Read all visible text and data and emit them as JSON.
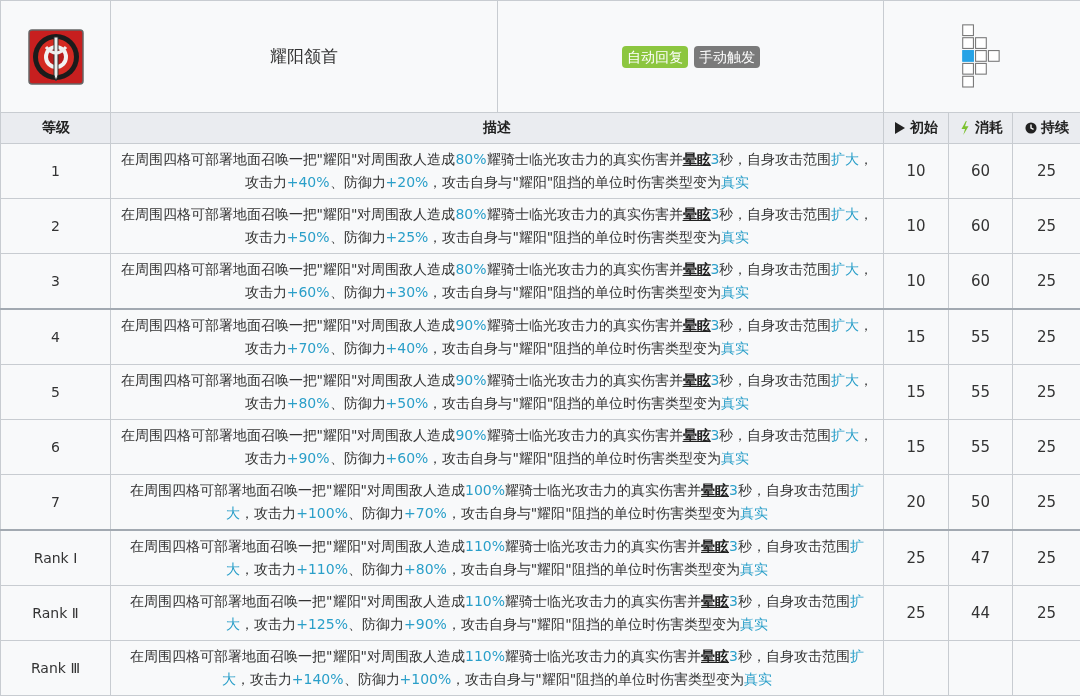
{
  "skill": {
    "name": "耀阳颔首",
    "tags": [
      {
        "label": "自动回复",
        "color": "#8cc63f"
      },
      {
        "label": "手动触发",
        "color": "#7a7a7a"
      }
    ]
  },
  "columns": [
    {
      "label": "等级",
      "kind": "level"
    },
    {
      "label": "描述",
      "kind": "description"
    },
    {
      "label": "初始",
      "kind": "initial"
    },
    {
      "label": "消耗",
      "kind": "cost"
    },
    {
      "label": "持续",
      "kind": "duration"
    }
  ],
  "rows": [
    {
      "level": "1",
      "description": [
        {
          "kind": "text",
          "text": "在周围四格可部署地面召唤一把\"耀阳\"对周围敌人造成"
        },
        {
          "kind": "value",
          "text": "80%"
        },
        {
          "kind": "text",
          "text": "耀骑士临光攻击力的真实伤害并"
        },
        {
          "kind": "term",
          "text": "晕眩"
        },
        {
          "kind": "value",
          "text": "3"
        },
        {
          "kind": "text",
          "text": "秒，自身攻击范围"
        },
        {
          "kind": "keyword",
          "text": "扩大"
        },
        {
          "kind": "text",
          "text": "，攻击力"
        },
        {
          "kind": "value",
          "text": "+40%"
        },
        {
          "kind": "text",
          "text": "、防御力"
        },
        {
          "kind": "value",
          "text": "+20%"
        },
        {
          "kind": "text",
          "text": "，攻击自身与\"耀阳\"阻挡的单位时伤害类型变为"
        },
        {
          "kind": "keyword",
          "text": "真实"
        }
      ],
      "initial": "10",
      "cost": "60",
      "duration": "25"
    },
    {
      "level": "2",
      "description": [
        {
          "kind": "text",
          "text": "在周围四格可部署地面召唤一把\"耀阳\"对周围敌人造成"
        },
        {
          "kind": "value",
          "text": "80%"
        },
        {
          "kind": "text",
          "text": "耀骑士临光攻击力的真实伤害并"
        },
        {
          "kind": "term",
          "text": "晕眩"
        },
        {
          "kind": "value",
          "text": "3"
        },
        {
          "kind": "text",
          "text": "秒，自身攻击范围"
        },
        {
          "kind": "keyword",
          "text": "扩大"
        },
        {
          "kind": "text",
          "text": "，攻击力"
        },
        {
          "kind": "value",
          "text": "+50%"
        },
        {
          "kind": "text",
          "text": "、防御力"
        },
        {
          "kind": "value",
          "text": "+25%"
        },
        {
          "kind": "text",
          "text": "，攻击自身与\"耀阳\"阻挡的单位时伤害类型变为"
        },
        {
          "kind": "keyword",
          "text": "真实"
        }
      ],
      "initial": "10",
      "cost": "60",
      "duration": "25"
    },
    {
      "level": "3",
      "description": [
        {
          "kind": "text",
          "text": "在周围四格可部署地面召唤一把\"耀阳\"对周围敌人造成"
        },
        {
          "kind": "value",
          "text": "80%"
        },
        {
          "kind": "text",
          "text": "耀骑士临光攻击力的真实伤害并"
        },
        {
          "kind": "term",
          "text": "晕眩"
        },
        {
          "kind": "value",
          "text": "3"
        },
        {
          "kind": "text",
          "text": "秒，自身攻击范围"
        },
        {
          "kind": "keyword",
          "text": "扩大"
        },
        {
          "kind": "text",
          "text": "，攻击力"
        },
        {
          "kind": "value",
          "text": "+60%"
        },
        {
          "kind": "text",
          "text": "、防御力"
        },
        {
          "kind": "value",
          "text": "+30%"
        },
        {
          "kind": "text",
          "text": "，攻击自身与\"耀阳\"阻挡的单位时伤害类型变为"
        },
        {
          "kind": "keyword",
          "text": "真实"
        }
      ],
      "initial": "10",
      "cost": "60",
      "duration": "25"
    },
    {
      "level": "4",
      "description": [
        {
          "kind": "text",
          "text": "在周围四格可部署地面召唤一把\"耀阳\"对周围敌人造成"
        },
        {
          "kind": "value",
          "text": "90%"
        },
        {
          "kind": "text",
          "text": "耀骑士临光攻击力的真实伤害并"
        },
        {
          "kind": "term",
          "text": "晕眩"
        },
        {
          "kind": "value",
          "text": "3"
        },
        {
          "kind": "text",
          "text": "秒，自身攻击范围"
        },
        {
          "kind": "keyword",
          "text": "扩大"
        },
        {
          "kind": "text",
          "text": "，攻击力"
        },
        {
          "kind": "value",
          "text": "+70%"
        },
        {
          "kind": "text",
          "text": "、防御力"
        },
        {
          "kind": "value",
          "text": "+40%"
        },
        {
          "kind": "text",
          "text": "，攻击自身与\"耀阳\"阻挡的单位时伤害类型变为"
        },
        {
          "kind": "keyword",
          "text": "真实"
        }
      ],
      "initial": "15",
      "cost": "55",
      "duration": "25"
    },
    {
      "level": "5",
      "description": [
        {
          "kind": "text",
          "text": "在周围四格可部署地面召唤一把\"耀阳\"对周围敌人造成"
        },
        {
          "kind": "value",
          "text": "90%"
        },
        {
          "kind": "text",
          "text": "耀骑士临光攻击力的真实伤害并"
        },
        {
          "kind": "term",
          "text": "晕眩"
        },
        {
          "kind": "value",
          "text": "3"
        },
        {
          "kind": "text",
          "text": "秒，自身攻击范围"
        },
        {
          "kind": "keyword",
          "text": "扩大"
        },
        {
          "kind": "text",
          "text": "，攻击力"
        },
        {
          "kind": "value",
          "text": "+80%"
        },
        {
          "kind": "text",
          "text": "、防御力"
        },
        {
          "kind": "value",
          "text": "+50%"
        },
        {
          "kind": "text",
          "text": "，攻击自身与\"耀阳\"阻挡的单位时伤害类型变为"
        },
        {
          "kind": "keyword",
          "text": "真实"
        }
      ],
      "initial": "15",
      "cost": "55",
      "duration": "25"
    },
    {
      "level": "6",
      "description": [
        {
          "kind": "text",
          "text": "在周围四格可部署地面召唤一把\"耀阳\"对周围敌人造成"
        },
        {
          "kind": "value",
          "text": "90%"
        },
        {
          "kind": "text",
          "text": "耀骑士临光攻击力的真实伤害并"
        },
        {
          "kind": "term",
          "text": "晕眩"
        },
        {
          "kind": "value",
          "text": "3"
        },
        {
          "kind": "text",
          "text": "秒，自身攻击范围"
        },
        {
          "kind": "keyword",
          "text": "扩大"
        },
        {
          "kind": "text",
          "text": "，攻击力"
        },
        {
          "kind": "value",
          "text": "+90%"
        },
        {
          "kind": "text",
          "text": "、防御力"
        },
        {
          "kind": "value",
          "text": "+60%"
        },
        {
          "kind": "text",
          "text": "，攻击自身与\"耀阳\"阻挡的单位时伤害类型变为"
        },
        {
          "kind": "keyword",
          "text": "真实"
        }
      ],
      "initial": "15",
      "cost": "55",
      "duration": "25"
    },
    {
      "level": "7",
      "description": [
        {
          "kind": "text",
          "text": "在周围四格可部署地面召唤一把\"耀阳\"对周围敌人造成"
        },
        {
          "kind": "value",
          "text": "100%"
        },
        {
          "kind": "text",
          "text": "耀骑士临光攻击力的真实伤害并"
        },
        {
          "kind": "term",
          "text": "晕眩"
        },
        {
          "kind": "value",
          "text": "3"
        },
        {
          "kind": "text",
          "text": "秒，自身攻击范围"
        },
        {
          "kind": "keyword",
          "text": "扩大"
        },
        {
          "kind": "text",
          "text": "，攻击力"
        },
        {
          "kind": "value",
          "text": "+100%"
        },
        {
          "kind": "text",
          "text": "、防御力"
        },
        {
          "kind": "value",
          "text": "+70%"
        },
        {
          "kind": "text",
          "text": "，攻击自身与\"耀阳\"阻挡的单位时伤害类型变为"
        },
        {
          "kind": "keyword",
          "text": "真实"
        }
      ],
      "initial": "20",
      "cost": "50",
      "duration": "25"
    },
    {
      "level": "Rank Ⅰ",
      "description": [
        {
          "kind": "text",
          "text": "在周围四格可部署地面召唤一把\"耀阳\"对周围敌人造成"
        },
        {
          "kind": "value",
          "text": "110%"
        },
        {
          "kind": "text",
          "text": "耀骑士临光攻击力的真实伤害并"
        },
        {
          "kind": "term",
          "text": "晕眩"
        },
        {
          "kind": "value",
          "text": "3"
        },
        {
          "kind": "text",
          "text": "秒，自身攻击范围"
        },
        {
          "kind": "keyword",
          "text": "扩大"
        },
        {
          "kind": "text",
          "text": "，攻击力"
        },
        {
          "kind": "value",
          "text": "+110%"
        },
        {
          "kind": "text",
          "text": "、防御力"
        },
        {
          "kind": "value",
          "text": "+80%"
        },
        {
          "kind": "text",
          "text": "，攻击自身与\"耀阳\"阻挡的单位时伤害类型变为"
        },
        {
          "kind": "keyword",
          "text": "真实"
        }
      ],
      "initial": "25",
      "cost": "47",
      "duration": "25"
    },
    {
      "level": "Rank Ⅱ",
      "description": [
        {
          "kind": "text",
          "text": "在周围四格可部署地面召唤一把\"耀阳\"对周围敌人造成"
        },
        {
          "kind": "value",
          "text": "110%"
        },
        {
          "kind": "text",
          "text": "耀骑士临光攻击力的真实伤害并"
        },
        {
          "kind": "term",
          "text": "晕眩"
        },
        {
          "kind": "value",
          "text": "3"
        },
        {
          "kind": "text",
          "text": "秒，自身攻击范围"
        },
        {
          "kind": "keyword",
          "text": "扩大"
        },
        {
          "kind": "text",
          "text": "，攻击力"
        },
        {
          "kind": "value",
          "text": "+125%"
        },
        {
          "kind": "text",
          "text": "、防御力"
        },
        {
          "kind": "value",
          "text": "+90%"
        },
        {
          "kind": "text",
          "text": "，攻击自身与\"耀阳\"阻挡的单位时伤害类型变为"
        },
        {
          "kind": "keyword",
          "text": "真实"
        }
      ],
      "initial": "25",
      "cost": "44",
      "duration": "25"
    },
    {
      "level": "Rank Ⅲ",
      "description": [
        {
          "kind": "text",
          "text": "在周围四格可部署地面召唤一把\"耀阳\"对周围敌人造成"
        },
        {
          "kind": "value",
          "text": "110%"
        },
        {
          "kind": "text",
          "text": "耀骑士临光攻击力的真实伤害并"
        },
        {
          "kind": "term",
          "text": "晕眩"
        },
        {
          "kind": "value",
          "text": "3"
        },
        {
          "kind": "text",
          "text": "秒，自身攻击范围"
        },
        {
          "kind": "keyword",
          "text": "扩大"
        },
        {
          "kind": "text",
          "text": "，攻击力"
        },
        {
          "kind": "value",
          "text": "+140%"
        },
        {
          "kind": "text",
          "text": "、防御力"
        },
        {
          "kind": "value",
          "text": "+100%"
        },
        {
          "kind": "text",
          "text": "，攻击自身与\"耀阳\"阻挡的单位时伤害类型变为"
        },
        {
          "kind": "keyword",
          "text": "真实"
        }
      ]
    }
  ]
}
